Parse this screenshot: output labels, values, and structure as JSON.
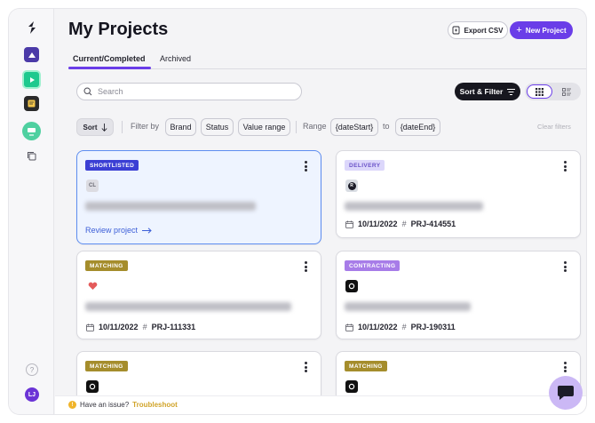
{
  "header": {
    "title": "My Projects",
    "export_label": "Export CSV",
    "new_label": "New Project"
  },
  "tabs": [
    {
      "label": "Current/Completed"
    },
    {
      "label": "Archived"
    }
  ],
  "toolbar": {
    "search_placeholder": "Search",
    "sort_filter_label": "Sort & Filter"
  },
  "filters": {
    "sort_label": "Sort",
    "filter_by": "Filter by",
    "chips": [
      "Brand",
      "Status",
      "Value range"
    ],
    "range_label": "Range",
    "date_start": "{dateStart}",
    "to": "to",
    "date_end": "{dateEnd}",
    "clear": "Clear filters"
  },
  "cards": [
    {
      "status": "SHORTLISTED",
      "logo": "CL",
      "review": "Review project"
    },
    {
      "status": "DELIVERY",
      "logo": "R",
      "date": "10/11/2022",
      "project_id": "PRJ-414551"
    },
    {
      "status": "MATCHING",
      "date": "10/11/2022",
      "project_id": "PRJ-111331"
    },
    {
      "status": "CONTRACTING",
      "date": "10/11/2022",
      "project_id": "PRJ-190311"
    },
    {
      "status": "MATCHING"
    },
    {
      "status": "MATCHING"
    }
  ],
  "footer": {
    "text": "Have an issue?",
    "link": "Troubleshoot"
  },
  "sidebar": {
    "avatar": "LJ",
    "help": "?"
  },
  "colors": {
    "accent": "#6a3de8",
    "selected_border": "#5d8df0",
    "shortlisted": "#3b3fd4",
    "delivery": "#dcd7fb",
    "matching": "#a58d2c",
    "contracting": "#a77ce8"
  },
  "icons": [
    "logo-icon",
    "app-icon",
    "search-icon",
    "filter-icon",
    "grid-view-icon",
    "list-view-icon",
    "calendar-icon",
    "hash-icon",
    "arrow-right-icon",
    "kebab-icon",
    "chat-icon",
    "warning-icon",
    "help-icon"
  ]
}
